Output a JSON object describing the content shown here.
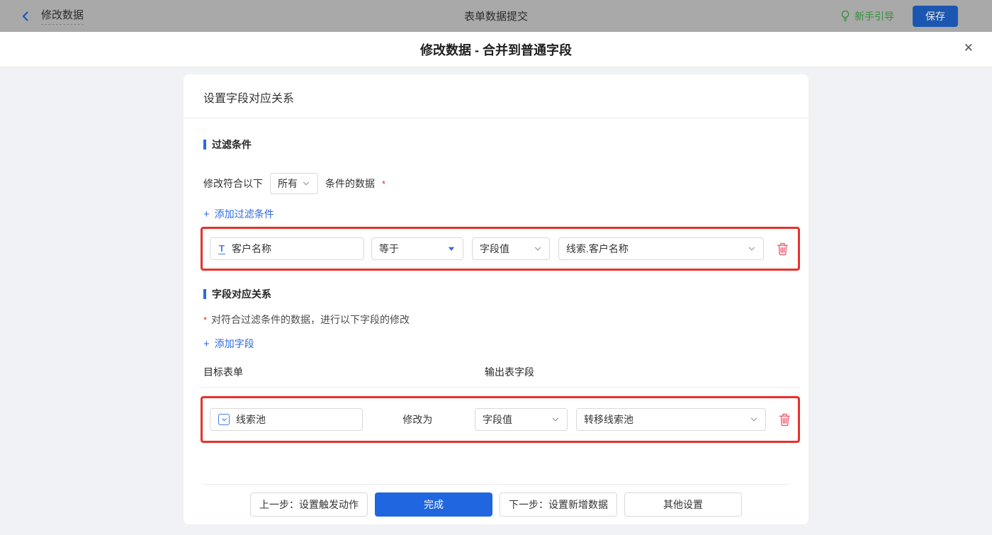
{
  "icons": {
    "plus": "+",
    "close": "✕"
  },
  "topbar": {
    "back_label": "修改数据",
    "title": "表单数据提交",
    "guide_label": "新手引导",
    "save_label": "保存"
  },
  "modal": {
    "title": "修改数据 - 合并到普通字段"
  },
  "card": {
    "header": "设置字段对应关系",
    "filter": {
      "title": "过滤条件",
      "prefix": "修改符合以下",
      "match_select": "所有",
      "suffix": "条件的数据",
      "required": "*",
      "add_link": "添加过滤条件",
      "row": {
        "field": "客户名称",
        "operator": "等于",
        "value_type": "字段值",
        "value": "线索.客户名称"
      }
    },
    "mapping": {
      "title": "字段对应关系",
      "required": "*",
      "description": "对符合过滤条件的数据，进行以下字段的修改",
      "add_link": "添加字段",
      "columns": {
        "target": "目标表单",
        "output": "输出表字段"
      },
      "row": {
        "field": "线索池",
        "action": "修改为",
        "value_type": "字段值",
        "value": "转移线索池"
      }
    },
    "footer": {
      "prev": "上一步：设置触发动作",
      "done": "完成",
      "next": "下一步：设置新增数据",
      "other": "其他设置"
    }
  },
  "colors": {
    "accent_blue": "#2d6ae0",
    "annotation_red": "#e8312a",
    "danger_pink": "#f0566e",
    "guide_green": "#378e3c",
    "save_blue": "#1b57b0",
    "topbar_gray": "#a9a9a9"
  }
}
